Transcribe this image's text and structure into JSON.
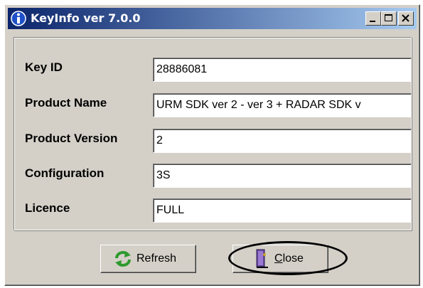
{
  "window": {
    "title": "KeyInfo ver 7.0.0",
    "title_icon": "info-icon",
    "controls": [
      "minimize-icon",
      "maximize-icon",
      "close-icon"
    ]
  },
  "fields": [
    {
      "label": "Key ID",
      "value": "28886081"
    },
    {
      "label": "Product Name",
      "value": "URM SDK ver 2 - ver 3 + RADAR SDK v"
    },
    {
      "label": "Product Version",
      "value": "2"
    },
    {
      "label": "Configuration",
      "value": "3S"
    },
    {
      "label": "Licence",
      "value": "FULL"
    }
  ],
  "buttons": {
    "refresh": {
      "label": "Refresh",
      "icon": "refresh-icon"
    },
    "close": {
      "label_mnemonic": "C",
      "label_rest": "lose",
      "icon": "door-exit-icon"
    }
  },
  "colors": {
    "titlebar_start": "#0a246a",
    "titlebar_end": "#a6caf0",
    "face": "#d4d0c8",
    "refresh_icon": "#2e9a2e"
  }
}
